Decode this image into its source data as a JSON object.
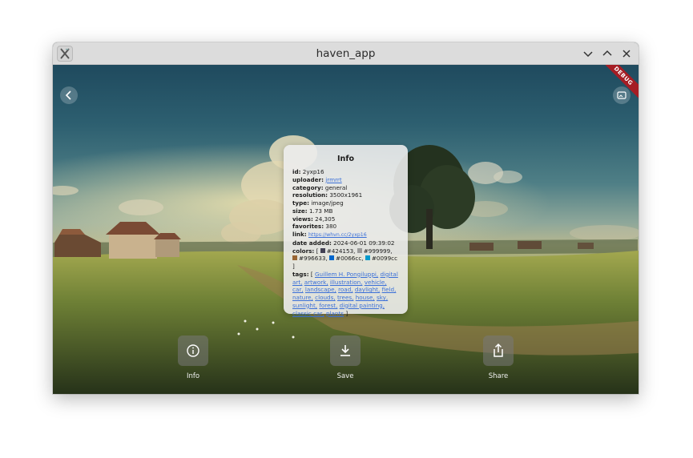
{
  "window": {
    "title": "haven_app",
    "debug_badge": "DEBUG"
  },
  "icons": {
    "app": "app-logo-icon",
    "minimize": "chevron-down-icon",
    "maximize": "chevron-up-icon",
    "close": "close-icon",
    "back": "chevron-left-icon",
    "fullscreen": "image-frame-icon",
    "info": "info-icon",
    "save": "download-icon",
    "share": "share-icon"
  },
  "info": {
    "title": "Info",
    "id_label": "id:",
    "id": "2yxp16",
    "uploader_label": "uploader:",
    "uploader": "jrmrrt",
    "category_label": "category:",
    "category": "general",
    "resolution_label": "resolution:",
    "resolution": "3500x1961",
    "type_label": "type:",
    "type": "image/jpeg",
    "size_label": "size:",
    "size": "1.73 MB",
    "views_label": "views:",
    "views": "24,305",
    "favorites_label": "favorites:",
    "favorites": "380",
    "link_label": "link:",
    "link": "https://whvn.cc/2yxp16",
    "date_label": "date added:",
    "date": "2024-06-01 09:39:02",
    "colors_label": "colors:",
    "colors": [
      {
        "hex": "#424153",
        "text": "#424153,"
      },
      {
        "hex": "#999999",
        "text": "#999999,"
      },
      {
        "hex": "#996633",
        "text": "#996633,"
      },
      {
        "hex": "#0066cc",
        "text": "#0066cc,"
      },
      {
        "hex": "#0099cc",
        "text": "#0099cc"
      }
    ],
    "tags_label": "tags:",
    "tags": [
      "Guillem H. Pongiluppi,",
      "digital art,",
      "artwork,",
      "illustration,",
      "vehicle,",
      "car,",
      "landscape,",
      "road,",
      "daylight,",
      "field,",
      "nature,",
      "clouds,",
      "trees,",
      "house,",
      "sky,",
      "sunlight,",
      "forest,",
      "digital painting,",
      "classic car,",
      "plants"
    ]
  },
  "actions": {
    "info": "Info",
    "save": "Save",
    "share": "Share"
  }
}
